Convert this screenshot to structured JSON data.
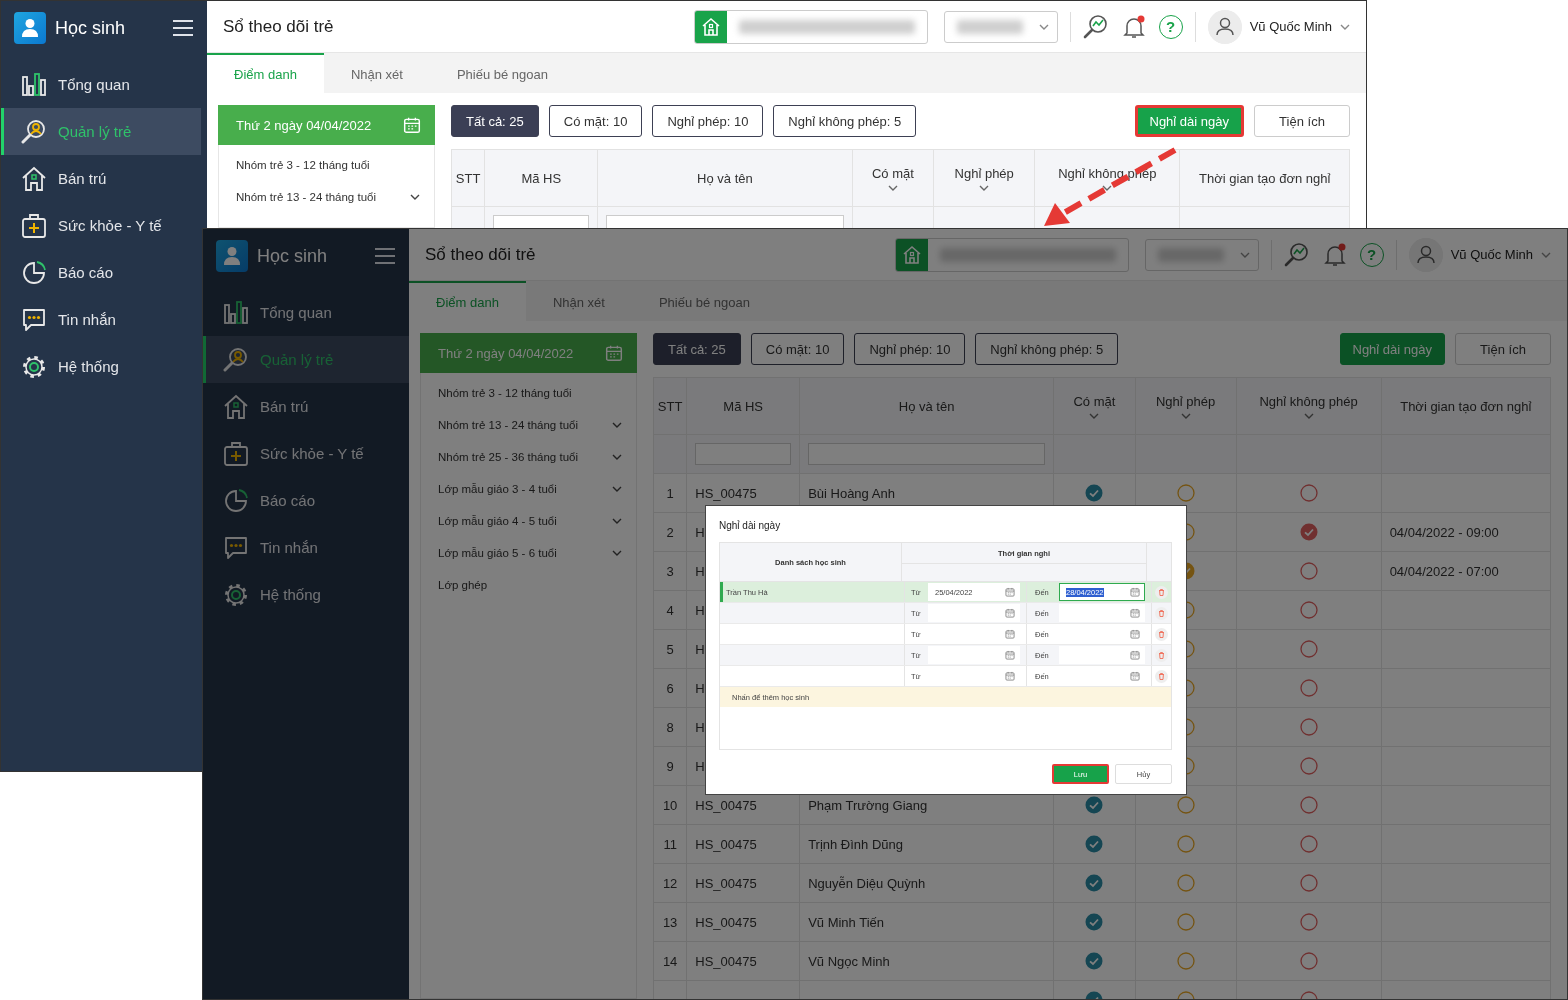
{
  "windows": [
    {
      "sidebar": {
        "title": "Học sinh",
        "items": [
          {
            "label": "Tổng quan",
            "selected": false
          },
          {
            "label": "Quản lý trẻ",
            "selected": true
          },
          {
            "label": "Bán trú",
            "selected": false
          },
          {
            "label": "Sức khỏe - Y tế",
            "selected": false
          },
          {
            "label": "Báo cáo",
            "selected": false
          },
          {
            "label": "Tin nhắn",
            "selected": false
          },
          {
            "label": "Hệ thống",
            "selected": false
          }
        ]
      },
      "header": {
        "title": "Sổ theo dõi trẻ",
        "help": "?",
        "user_name": "Vũ Quốc Minh"
      },
      "tabs": [
        {
          "label": "Điểm danh",
          "selected": true
        },
        {
          "label": "Nhận xét",
          "selected": false
        },
        {
          "label": "Phiếu bé ngoan",
          "selected": false
        }
      ],
      "date_panel": {
        "date": "Thứ 2 ngày 04/04/2022",
        "groups": [
          {
            "label": "Nhóm trẻ 3 - 12 tháng tuổi",
            "expandable": false
          },
          {
            "label": "Nhóm trẻ 13 - 24 tháng tuổi",
            "expandable": true
          }
        ]
      },
      "filters": [
        {
          "label": "Tất cả: 25",
          "selected": true
        },
        {
          "label": "Có mặt: 10",
          "selected": false
        },
        {
          "label": "Nghỉ phép: 10",
          "selected": false
        },
        {
          "label": "Nghỉ không phép: 5",
          "selected": false
        }
      ],
      "actions": [
        {
          "label": "Nghỉ dài ngày",
          "kind": "primary",
          "highlighted": true
        },
        {
          "label": "Tiện ích",
          "kind": "secondary",
          "highlighted": false
        }
      ],
      "table": {
        "columns": [
          {
            "label": "STT",
            "sortable": false
          },
          {
            "label": "Mã HS",
            "sortable": false
          },
          {
            "label": "Họ và tên",
            "sortable": false
          },
          {
            "label": "Có mặt",
            "sortable": true
          },
          {
            "label": "Nghỉ phép",
            "sortable": true
          },
          {
            "label": "Nghỉ không phép",
            "sortable": true
          },
          {
            "label": "Thời gian tạo đơn nghỉ",
            "sortable": false
          }
        ]
      }
    },
    {
      "sidebar": {
        "title": "Học sinh",
        "items": [
          {
            "label": "Tổng quan",
            "selected": false
          },
          {
            "label": "Quản lý trẻ",
            "selected": true
          },
          {
            "label": "Bán trú",
            "selected": false
          },
          {
            "label": "Sức khỏe - Y tế",
            "selected": false
          },
          {
            "label": "Báo cáo",
            "selected": false
          },
          {
            "label": "Tin nhắn",
            "selected": false
          },
          {
            "label": "Hệ thống",
            "selected": false
          }
        ]
      },
      "header": {
        "title": "Sổ theo dõi trẻ",
        "help": "?",
        "user_name": "Vũ Quốc Minh"
      },
      "tabs": [
        {
          "label": "Điểm danh",
          "selected": true
        },
        {
          "label": "Nhận xét",
          "selected": false
        },
        {
          "label": "Phiếu bé ngoan",
          "selected": false
        }
      ],
      "date_panel": {
        "date": "Thứ 2 ngày 04/04/2022",
        "groups": [
          {
            "label": "Nhóm trẻ 3 - 12 tháng tuổi",
            "expandable": false
          },
          {
            "label": "Nhóm trẻ 13 - 24 tháng tuổi",
            "expandable": true
          },
          {
            "label": "Nhóm trẻ 25 - 36 tháng tuổi",
            "expandable": true
          },
          {
            "label": "Lớp mẫu giáo 3 - 4 tuổi",
            "expandable": true
          },
          {
            "label": "Lớp mẫu giáo 4 - 5 tuổi",
            "expandable": true
          },
          {
            "label": "Lớp mẫu giáo 5 - 6 tuổi",
            "expandable": true
          },
          {
            "label": "Lớp ghép",
            "expandable": false
          }
        ]
      },
      "filters": [
        {
          "label": "Tất cả: 25",
          "selected": true
        },
        {
          "label": "Có mặt: 10",
          "selected": false
        },
        {
          "label": "Nghỉ phép: 10",
          "selected": false
        },
        {
          "label": "Nghỉ không phép: 5",
          "selected": false
        }
      ],
      "actions": [
        {
          "label": "Nghỉ dài ngày",
          "kind": "primary",
          "highlighted": false
        },
        {
          "label": "Tiện ích",
          "kind": "secondary",
          "highlighted": false
        }
      ],
      "table": {
        "columns": [
          {
            "label": "STT",
            "sortable": false
          },
          {
            "label": "Mã HS",
            "sortable": false
          },
          {
            "label": "Họ và tên",
            "sortable": false
          },
          {
            "label": "Có mặt",
            "sortable": true
          },
          {
            "label": "Nghỉ phép",
            "sortable": true
          },
          {
            "label": "Nghỉ không phép",
            "sortable": true
          },
          {
            "label": "Thời gian tạo đơn nghỉ",
            "sortable": false
          }
        ],
        "rows": [
          {
            "stt": "1",
            "code": "HS_00475",
            "name": "Bùi Hoàng Anh",
            "present": true,
            "excused": false,
            "unexcused": false
          },
          {
            "stt": "2",
            "code": "H",
            "excused": false,
            "unexcused": true,
            "time": "04/04/2022 - 09:00"
          },
          {
            "stt": "3",
            "code": "H",
            "excused": true,
            "unexcused": false,
            "time": "04/04/2022 - 07:00"
          },
          {
            "stt": "4",
            "code": "H",
            "excused": false,
            "unexcused": false
          },
          {
            "stt": "5",
            "code": "H",
            "excused": false,
            "unexcused": false
          },
          {
            "stt": "6",
            "code": "H",
            "excused": false,
            "unexcused": false
          },
          {
            "stt": "8",
            "code": "H",
            "excused": false,
            "unexcused": false
          },
          {
            "stt": "9",
            "code": "H",
            "excused": false,
            "unexcused": false
          },
          {
            "stt": "10",
            "code": "HS_00475",
            "name": "Phạm Trường Giang",
            "present": true,
            "excused": false,
            "unexcused": false
          },
          {
            "stt": "11",
            "code": "HS_00475",
            "name": "Trịnh Đình Dũng",
            "present": true,
            "excused": false,
            "unexcused": false
          },
          {
            "stt": "12",
            "code": "HS_00475",
            "name": "Nguyễn Diệu Quỳnh",
            "present": true,
            "excused": false,
            "unexcused": false
          },
          {
            "stt": "13",
            "code": "HS_00475",
            "name": "Vũ Minh Tiến",
            "present": true,
            "excused": false,
            "unexcused": false
          },
          {
            "stt": "14",
            "code": "HS_00475",
            "name": "Vũ Ngọc Minh",
            "present": true,
            "excused": false,
            "unexcused": false
          },
          {
            "present": true,
            "excused": false,
            "unexcused": false
          }
        ]
      },
      "dialog": {
        "title": "Nghỉ dài ngày",
        "student_column": "Danh sách học sinh",
        "period_column": "Thời gian nghỉ",
        "rows": [
          {
            "student": "Trần Thu Hà",
            "selected": true,
            "from_label": "Từ",
            "from": {
              "value": "25/04/2022",
              "focused": false
            },
            "to_label": "Đến",
            "to": {
              "value": "28/04/2022",
              "focused": true
            }
          },
          {
            "selected": false,
            "from_label": "Từ",
            "from": {
              "focused": false
            },
            "to_label": "Đến",
            "to": {
              "focused": false
            }
          },
          {
            "selected": false,
            "from_label": "Từ",
            "from": {
              "focused": false
            },
            "to_label": "Đến",
            "to": {
              "focused": false
            }
          },
          {
            "selected": false,
            "from_label": "Từ",
            "from": {
              "focused": false
            },
            "to_label": "Đến",
            "to": {
              "focused": false
            }
          },
          {
            "selected": false,
            "from_label": "Từ",
            "from": {
              "focused": false
            },
            "to_label": "Đến",
            "to": {
              "focused": false
            }
          }
        ],
        "add_hint": "Nhấn để thêm học sinh",
        "buttons": [
          {
            "label": "Lưu",
            "kind": "primary",
            "highlighted": true
          },
          {
            "label": "Hủy",
            "kind": "secondary",
            "highlighted": false
          }
        ]
      }
    }
  ]
}
